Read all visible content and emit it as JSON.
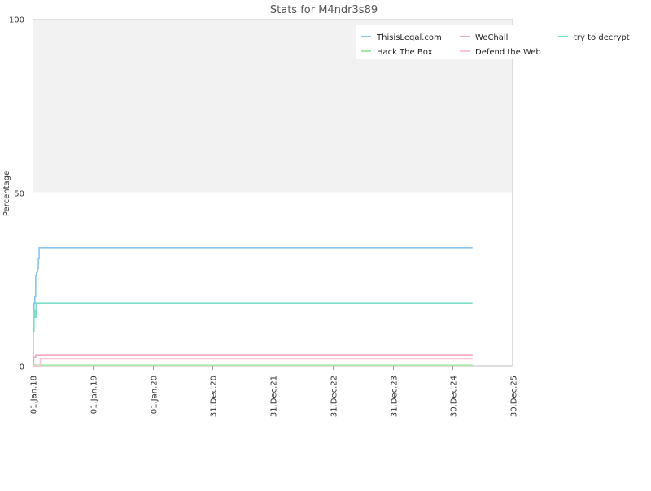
{
  "chart_data": {
    "type": "line",
    "title": "Stats for M4ndr3s89",
    "xlabel": "",
    "ylabel": "Percentage",
    "ylim": [
      0,
      100
    ],
    "xlim": [
      "2018-01-01",
      "2025-12-30"
    ],
    "grid": true,
    "legend_position": "top-right",
    "y_ticks": [
      {
        "value": 0,
        "label": "0"
      },
      {
        "value": 50,
        "label": "50"
      },
      {
        "value": 100,
        "label": "100"
      }
    ],
    "x_ticks": [
      {
        "date": "2018-01-01",
        "label": "01.Jan.18"
      },
      {
        "date": "2019-01-01",
        "label": "01.Jan.19"
      },
      {
        "date": "2020-01-01",
        "label": "01.Jan.20"
      },
      {
        "date": "2020-12-31",
        "label": "31.Dec.20"
      },
      {
        "date": "2021-12-31",
        "label": "31.Dec.21"
      },
      {
        "date": "2022-12-31",
        "label": "31.Dec.22"
      },
      {
        "date": "2023-12-31",
        "label": "31.Dec.23"
      },
      {
        "date": "2024-12-30",
        "label": "30.Dec.24"
      },
      {
        "date": "2025-12-30",
        "label": "30.Dec.25"
      }
    ],
    "series": [
      {
        "name": "ThisisLegal.com",
        "color": "#88c4f0",
        "points": [
          [
            "2018-01-01",
            0
          ],
          [
            "2018-01-05",
            16
          ],
          [
            "2018-01-10",
            18
          ],
          [
            "2018-01-15",
            20
          ],
          [
            "2018-01-20",
            26
          ],
          [
            "2018-01-25",
            27
          ],
          [
            "2018-02-01",
            28
          ],
          [
            "2018-02-05",
            31
          ],
          [
            "2018-02-10",
            34
          ],
          [
            "2025-04-30",
            34
          ]
        ]
      },
      {
        "name": "WeChall",
        "color": "#f4a6c0",
        "points": [
          [
            "2018-01-01",
            0
          ],
          [
            "2018-01-08",
            2.5
          ],
          [
            "2018-01-20",
            3
          ],
          [
            "2025-04-30",
            3
          ]
        ]
      },
      {
        "name": "try to decrypt",
        "color": "#7ddcc6",
        "points": [
          [
            "2018-01-01",
            0
          ],
          [
            "2018-01-05",
            10
          ],
          [
            "2018-01-10",
            14
          ],
          [
            "2018-01-14",
            16
          ],
          [
            "2018-01-20",
            14
          ],
          [
            "2018-01-22",
            18
          ],
          [
            "2025-04-30",
            18
          ]
        ]
      },
      {
        "name": "Hack The Box",
        "color": "#a8e6a8",
        "points": [
          [
            "2018-01-01",
            0.2
          ],
          [
            "2025-04-30",
            0.2
          ]
        ]
      },
      {
        "name": "Defend the Web",
        "color": "#f7c6d2",
        "points": [
          [
            "2018-01-01",
            0
          ],
          [
            "2018-02-15",
            0
          ],
          [
            "2018-02-17",
            2
          ],
          [
            "2025-04-30",
            2
          ]
        ]
      }
    ]
  }
}
